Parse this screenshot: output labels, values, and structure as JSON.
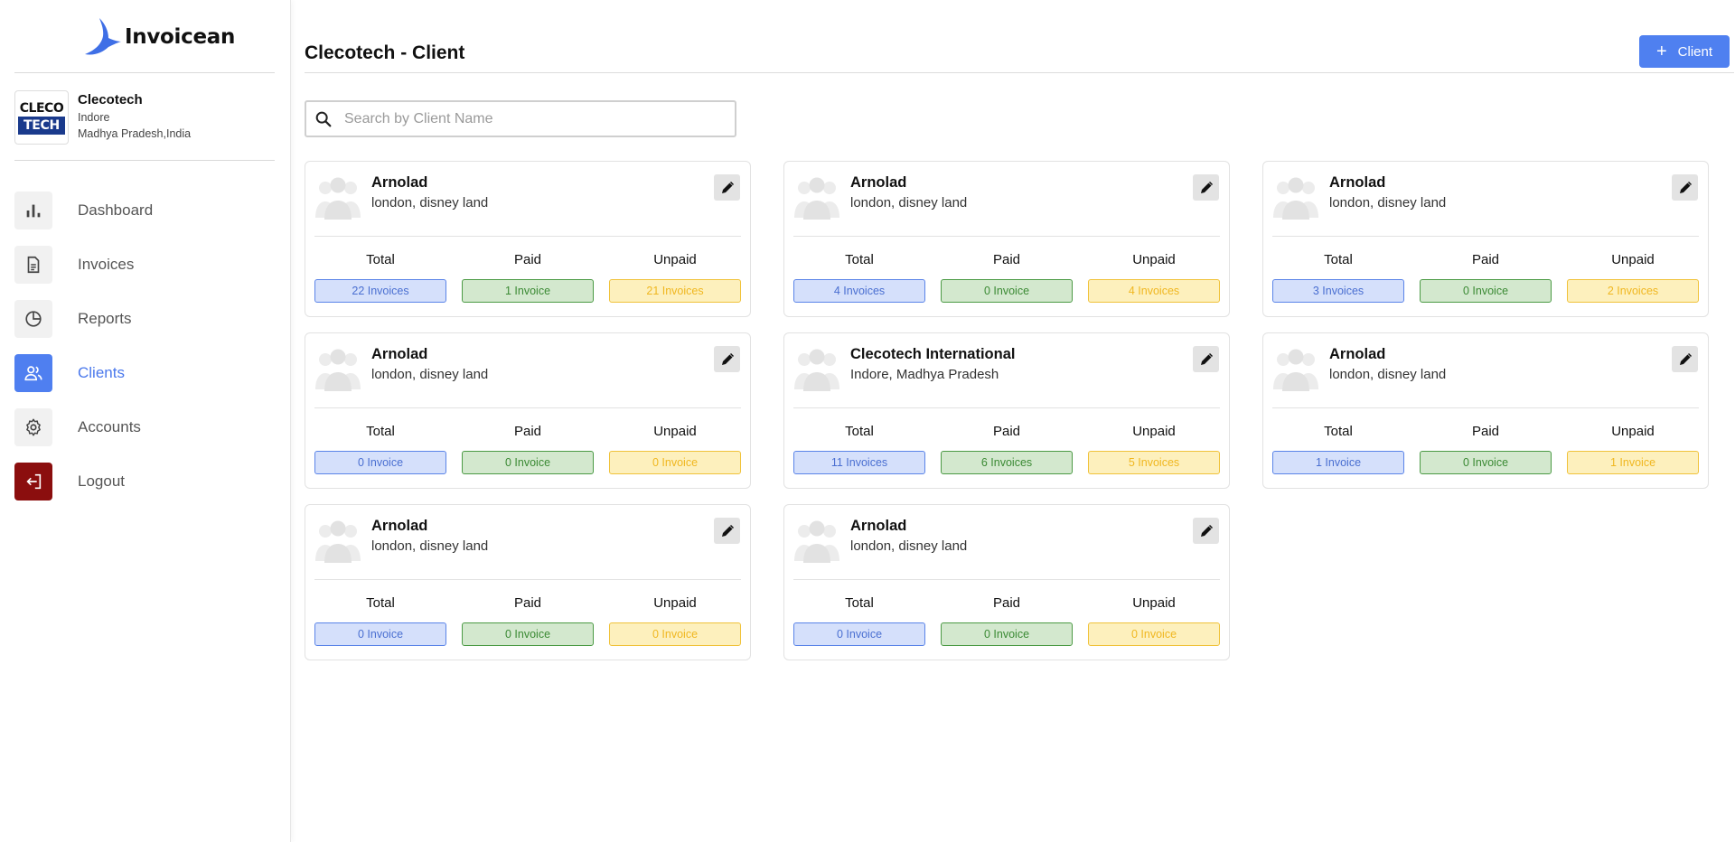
{
  "app": {
    "name": "Invoicean"
  },
  "company": {
    "logo_line1": "CLECO",
    "logo_line2": "TECH",
    "name": "Clecotech",
    "city": "Indore",
    "region": "Madhya Pradesh,India"
  },
  "nav": [
    {
      "label": "Dashboard",
      "icon": "bar-chart-icon"
    },
    {
      "label": "Invoices",
      "icon": "document-icon"
    },
    {
      "label": "Reports",
      "icon": "pie-chart-icon"
    },
    {
      "label": "Clients",
      "icon": "users-icon"
    },
    {
      "label": "Accounts",
      "icon": "gear-icon"
    },
    {
      "label": "Logout",
      "icon": "logout-icon"
    }
  ],
  "header": {
    "title": "Clecotech - Client",
    "add_button": "Client",
    "add_button_icon": "plus-icon"
  },
  "search": {
    "placeholder": "Search by Client Name",
    "value": ""
  },
  "stat_labels": {
    "total": "Total",
    "paid": "Paid",
    "unpaid": "Unpaid"
  },
  "clients": [
    {
      "name": "Arnolad",
      "address": "london, disney land",
      "total": "22 Invoices",
      "paid": "1 Invoice",
      "unpaid": "21 Invoices"
    },
    {
      "name": "Arnolad",
      "address": "london, disney land",
      "total": "4 Invoices",
      "paid": "0 Invoice",
      "unpaid": "4 Invoices"
    },
    {
      "name": "Arnolad",
      "address": "london, disney land",
      "total": "3 Invoices",
      "paid": "0 Invoice",
      "unpaid": "2 Invoices"
    },
    {
      "name": "Arnolad",
      "address": "london, disney land",
      "total": "0 Invoice",
      "paid": "0 Invoice",
      "unpaid": "0 Invoice"
    },
    {
      "name": "Clecotech International",
      "address": "Indore, Madhya Pradesh",
      "total": "11 Invoices",
      "paid": "6 Invoices",
      "unpaid": "5 Invoices"
    },
    {
      "name": "Arnolad",
      "address": "london, disney land",
      "total": "1 Invoice",
      "paid": "0 Invoice",
      "unpaid": "1 Invoice"
    },
    {
      "name": "Arnolad",
      "address": "london, disney land",
      "total": "0 Invoice",
      "paid": "0 Invoice",
      "unpaid": "0 Invoice"
    },
    {
      "name": "Arnolad",
      "address": "london, disney land",
      "total": "0 Invoice",
      "paid": "0 Invoice",
      "unpaid": "0 Invoice"
    }
  ],
  "colors": {
    "accent": "#4f80f0",
    "logout": "#8b0e0e",
    "total": "#5a84e8",
    "paid": "#4b9a44",
    "unpaid": "#f0c23a"
  }
}
